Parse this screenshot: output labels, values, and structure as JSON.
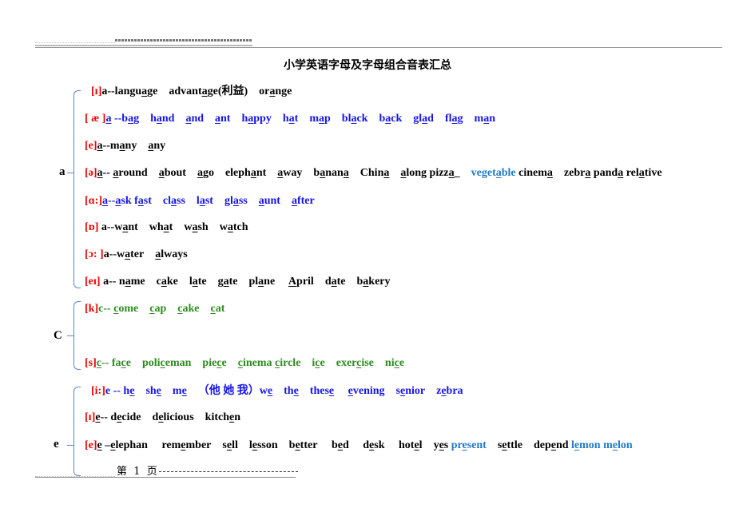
{
  "document": {
    "title": "小学英语字母及字母组合音表汇总",
    "footer": {
      "page_label": "第  1  页"
    }
  },
  "groups": [
    {
      "letter": "a",
      "rows": [
        {
          "phonetic": "[ɪ]",
          "color": "black",
          "words": [
            "a--langu<u>a</u>ge",
            "advant<u>a</u>ge(利益)",
            "or<u>a</u>nge"
          ]
        },
        {
          "phonetic": "[ æ ]",
          "color": "blue",
          "words": [
            "<u>a</u> --b<u>a</u>g",
            "h<u>a</u>nd",
            "<u>a</u>nd",
            "<u>a</u>nt",
            "h<u>a</u>ppy",
            "h<u>a</u>t",
            "m<u>a</u>p",
            "bl<u>a</u>ck",
            "b<u>a</u>ck",
            "gl<u>a</u>d",
            "fl<u>a</u>g",
            "m<u>a</u>n"
          ]
        },
        {
          "phonetic": "[e]",
          "color": "black",
          "words": [
            "<u>a</u>--m<u>a</u>ny",
            "<u>a</u>ny"
          ]
        },
        {
          "phonetic": "[ə]",
          "color": "black",
          "words": [
            "<u>a</u>-- <u>a</u>round",
            "<u>a</u>bout",
            "<u>a</u>go",
            "eleph<u>a</u>nt",
            "<u>a</u>way",
            "b<u>a</u>nan<u>a</u>",
            "Chin<u>a</u>",
            "<u>a</u>long pizz<u>a</u>_",
            "<span class='lblue'>veget<u>a</u>ble</span> cinem<u>a</u>",
            "zebr<u>a</u> pand<u>a</u> rel<u>a</u>tive"
          ]
        },
        {
          "phonetic": "[ɑ:]",
          "color": "blue",
          "words": [
            "<u>a</u>--<u>a</u>sk f<u>a</u>st",
            "cl<u>a</u>ss",
            "l<u>a</u>st",
            "gl<u>a</u>ss",
            "<u>a</u>unt",
            "<u>a</u>fter"
          ]
        },
        {
          "phonetic": "[ɒ]",
          "color": "black",
          "words": [
            " a--w<u>a</u>nt",
            "wh<u>a</u>t",
            "w<u>a</u>sh",
            "w<u>a</u>tch"
          ]
        },
        {
          "phonetic": "[ɔ: ]",
          "color": "black",
          "words": [
            "a--w<u>a</u>ter",
            "<u>a</u>lways"
          ]
        },
        {
          "phonetic": "[eɪ]",
          "color": "black",
          "words": [
            " a-- n<u>a</u>me",
            "c<u>a</u>ke",
            "l<u>a</u>te",
            "g<u>a</u>te",
            "pl<u>a</u>ne",
            " <u>A</u>pril",
            "d<u>a</u>te",
            "b<u>a</u>kery"
          ]
        }
      ]
    },
    {
      "letter": "C",
      "rows": [
        {
          "phonetic": "[k]",
          "color": "green",
          "words": [
            "c-- <u>c</u>ome",
            "<u>c</u>ap",
            "<u>c</u>ake",
            "<u>c</u>at"
          ]
        },
        {
          "phonetic": "[s]",
          "color": "green",
          "words": [
            "<u>c</u>-- fa<u>c</u>e",
            "poli<u>c</u>eman",
            "pie<u>c</u>e",
            "<u>c</u>inema <u>c</u>ircle",
            "i<u>c</u>e",
            "exer<u>c</u>ise",
            "ni<u>c</u>e"
          ]
        }
      ]
    },
    {
      "letter": "e",
      "rows": [
        {
          "phonetic": "[i:]",
          "color": "blue",
          "words": [
            "e -- h<u>e</u>",
            "sh<u>e</u>",
            "m<u>e</u>",
            "（他 她 我）w<u>e</u>",
            "th<u>e</u>",
            "thes<u>e</u>",
            " <u>e</u>vening",
            "s<u>e</u>nior",
            "z<u>e</u>bra"
          ]
        },
        {
          "phonetic": "[ɪ]",
          "color": "black",
          "words": [
            "<u>e</u>-- d<u>e</u>cide",
            "d<u>e</u>licious",
            "kitch<u>e</u>n"
          ]
        },
        {
          "phonetic": "[e]",
          "color": "black",
          "words": [
            "<u>e</u> –<u>e</u>lephan",
            " rem<u>e</u>mber",
            "s<u>e</u>ll",
            "l<u>e</u>sson",
            "b<u>e</u>tter",
            " b<u>e</u>d",
            " d<u>e</u>sk",
            " hot<u>e</u>l",
            "y<u>e</u>s <span class='lblue'>pr<u>e</u>sent</span>",
            "s<u>e</u>ttle",
            "dep<u>e</u>nd <span class='lblue'>l<u>e</u>mon m<u>e</u>lon</span>"
          ]
        }
      ]
    }
  ]
}
